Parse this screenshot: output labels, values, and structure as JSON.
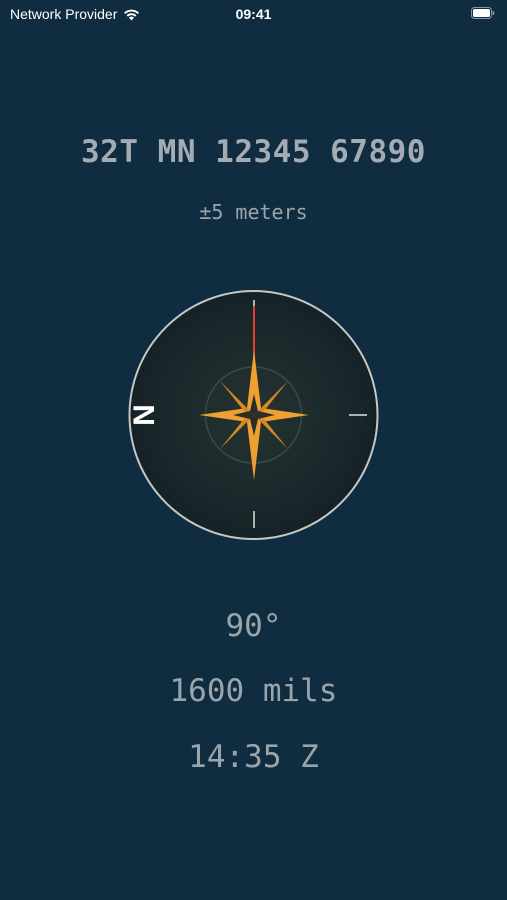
{
  "status_bar": {
    "carrier": "Network Provider",
    "time": "09:41",
    "icons": [
      "wifi-icon",
      "battery-icon"
    ]
  },
  "location": {
    "grid_reference": "32T MN 12345 67890",
    "accuracy": "±5 meters"
  },
  "compass": {
    "north_label": "N",
    "icon": "compass-rose-icon",
    "colors": {
      "rose": "#f0a030",
      "needle": "#e0402a",
      "dial": "#1c2a2a",
      "ring": "#c8ccc8"
    }
  },
  "heading": {
    "degrees": "90°",
    "mils": "1600 mils",
    "zulu_time": "14:35 Z"
  },
  "colors": {
    "background": "#0f2c40",
    "text": "#9aa4ab"
  }
}
